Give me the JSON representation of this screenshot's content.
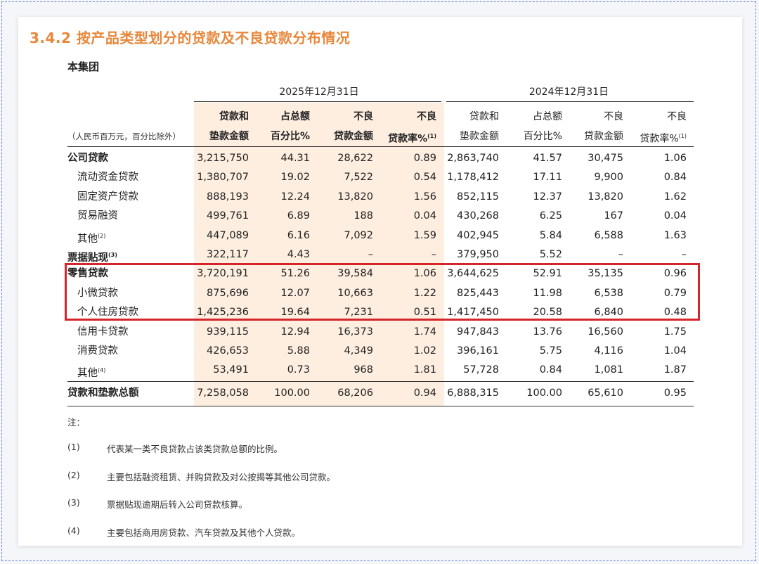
{
  "title": "3.4.2 按产品类型划分的贷款及不良贷款分布情况",
  "subtitle": "本集团",
  "period_2025": "2025年12月31日",
  "period_2024": "2024年12月31日",
  "units": "（人民币百万元，百分比除外）",
  "headers": {
    "c1": [
      "贷款和",
      "垫款金额"
    ],
    "c2": [
      "占总额",
      "百分比%"
    ],
    "c3": [
      "不良",
      "贷款金额"
    ],
    "c4": [
      "不良",
      "贷款率%"
    ],
    "c4_sup": "(1)",
    "c5": [
      "贷款和",
      "垫款金额"
    ],
    "c6": [
      "占总额",
      "百分比%"
    ],
    "c7": [
      "不良",
      "贷款金额"
    ],
    "c8": [
      "不良",
      "贷款率%"
    ],
    "c8_sup": "(1)"
  },
  "rows": [
    {
      "label": "公司贷款",
      "sup": "",
      "v": [
        "3,215,750",
        "44.31",
        "28,622",
        "0.89",
        "2,863,740",
        "41.57",
        "30,475",
        "1.06"
      ]
    },
    {
      "label": "流动资金贷款",
      "sup": "",
      "v": [
        "1,380,707",
        "19.02",
        "7,522",
        "0.54",
        "1,178,412",
        "17.11",
        "9,900",
        "0.84"
      ]
    },
    {
      "label": "固定资产贷款",
      "sup": "",
      "v": [
        "888,193",
        "12.24",
        "13,820",
        "1.56",
        "852,115",
        "12.37",
        "13,820",
        "1.62"
      ]
    },
    {
      "label": "贸易融资",
      "sup": "",
      "v": [
        "499,761",
        "6.89",
        "188",
        "0.04",
        "430,268",
        "6.25",
        "167",
        "0.04"
      ]
    },
    {
      "label": "其他",
      "sup": "(2)",
      "v": [
        "447,089",
        "6.16",
        "7,092",
        "1.59",
        "402,945",
        "5.84",
        "6,588",
        "1.63"
      ]
    },
    {
      "label": "票据贴现",
      "sup": "(3)",
      "v": [
        "322,117",
        "4.43",
        "–",
        "–",
        "379,950",
        "5.52",
        "–",
        "–"
      ]
    },
    {
      "label": "零售贷款",
      "sup": "",
      "v": [
        "3,720,191",
        "51.26",
        "39,584",
        "1.06",
        "3,644,625",
        "52.91",
        "35,135",
        "0.96"
      ]
    },
    {
      "label": "小微贷款",
      "sup": "",
      "v": [
        "875,696",
        "12.07",
        "10,663",
        "1.22",
        "825,443",
        "11.98",
        "6,538",
        "0.79"
      ]
    },
    {
      "label": "个人住房贷款",
      "sup": "",
      "v": [
        "1,425,236",
        "19.64",
        "7,231",
        "0.51",
        "1,417,450",
        "20.58",
        "6,840",
        "0.48"
      ]
    },
    {
      "label": "信用卡贷款",
      "sup": "",
      "v": [
        "939,115",
        "12.94",
        "16,373",
        "1.74",
        "947,843",
        "13.76",
        "16,560",
        "1.75"
      ]
    },
    {
      "label": "消费贷款",
      "sup": "",
      "v": [
        "426,653",
        "5.88",
        "4,349",
        "1.02",
        "396,161",
        "5.75",
        "4,116",
        "1.04"
      ]
    },
    {
      "label": "其他",
      "sup": "(4)",
      "v": [
        "53,491",
        "0.73",
        "968",
        "1.81",
        "57,728",
        "0.84",
        "1,081",
        "1.87"
      ]
    }
  ],
  "total": {
    "label": "贷款和垫款总额",
    "v": [
      "7,258,058",
      "100.00",
      "68,206",
      "0.94",
      "6,888,315",
      "100.00",
      "65,610",
      "0.95"
    ]
  },
  "notes_head": "注：",
  "notes": [
    {
      "num": "(1)",
      "text": "代表某一类不良贷款占该类贷款总额的比例。"
    },
    {
      "num": "(2)",
      "text": "主要包括融资租赁、并购贷款及对公按揭等其他公司贷款。"
    },
    {
      "num": "(3)",
      "text": "票据贴现逾期后转入公司贷款核算。"
    },
    {
      "num": "(4)",
      "text": "主要包括商用房贷款、汽车贷款及其他个人贷款。"
    }
  ]
}
